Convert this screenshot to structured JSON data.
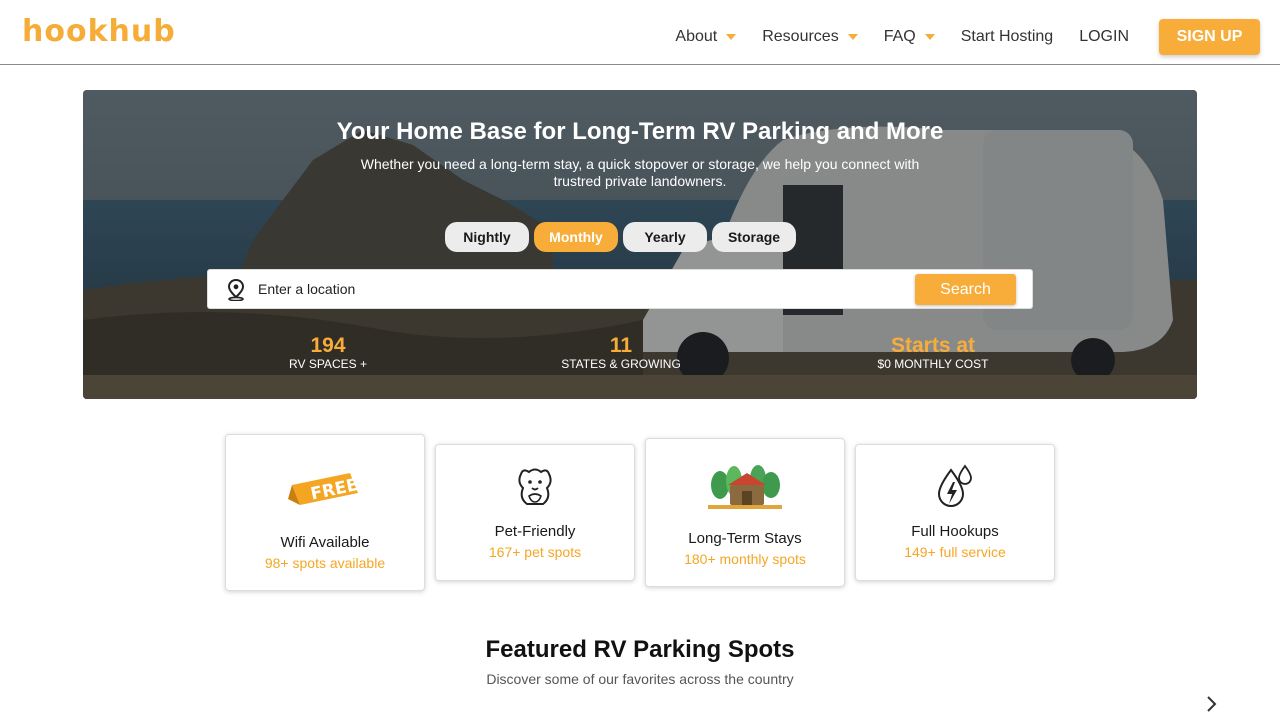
{
  "nav": {
    "logo_text": "hookhub",
    "items": [
      {
        "label": "About",
        "has_dropdown": true
      },
      {
        "label": "Resources",
        "has_dropdown": true
      },
      {
        "label": "FAQ",
        "has_dropdown": true
      },
      {
        "label": "Start Hosting",
        "has_dropdown": false
      },
      {
        "label": "LOGIN",
        "has_dropdown": false
      }
    ],
    "signup_label": "SIGN UP"
  },
  "hero": {
    "title": "Your Home Base for Long-Term RV Parking and More",
    "subtitle": "Whether you need a long-term stay, a quick stopover or storage, we help you connect with trustred private landowners.",
    "tabs": [
      {
        "label": "Nightly",
        "active": false
      },
      {
        "label": "Monthly",
        "active": true
      },
      {
        "label": "Yearly",
        "active": false
      },
      {
        "label": "Storage",
        "active": false
      }
    ],
    "search": {
      "placeholder": "Enter a location",
      "button_label": "Search"
    },
    "stats": [
      {
        "value": "194",
        "label": "RV SPACES +"
      },
      {
        "value": "11",
        "label": "STATES & GROWING"
      },
      {
        "value": "Starts at",
        "label": "$0 MONTHLY COST"
      }
    ]
  },
  "features": [
    {
      "title": "Wifi Available",
      "subtitle": "98+ spots available",
      "icon": "free-badge-icon",
      "badge_text": "FREE"
    },
    {
      "title": "Pet-Friendly",
      "subtitle": "167+ pet spots",
      "icon": "pet-icon"
    },
    {
      "title": "Long-Term Stays",
      "subtitle": "180+ monthly spots",
      "icon": "campsite-icon"
    },
    {
      "title": "Full Hookups",
      "subtitle": "149+ full service",
      "icon": "water-power-icon"
    }
  ],
  "featured": {
    "title": "Featured RV Parking Spots",
    "subtitle": "Discover some of our favorites across the country"
  },
  "colors": {
    "accent": "#f8ad3a",
    "accent_text": "#f6a623"
  }
}
